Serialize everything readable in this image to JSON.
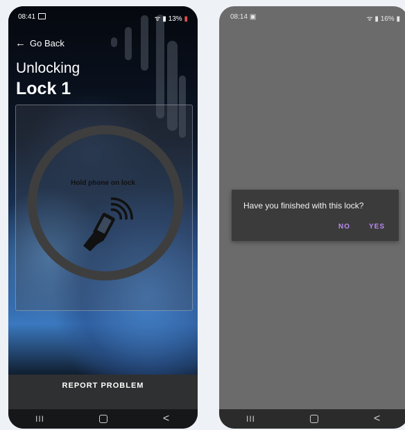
{
  "left_phone": {
    "status_bar": {
      "time": "08:41",
      "battery": "13%"
    },
    "header": {
      "back_label": "Go Back",
      "subtitle": "Unlocking",
      "title": "Lock 1"
    },
    "nfc_panel": {
      "instruction": "Hold phone on lock"
    },
    "report_button": {
      "label": "REPORT PROBLEM"
    },
    "nav": {
      "recents": "III",
      "back": "<"
    }
  },
  "right_phone": {
    "status_bar": {
      "time": "08:14",
      "battery": "16%"
    },
    "dialog": {
      "message": "Have you finished with this lock?",
      "no_label": "NO",
      "yes_label": "YES"
    },
    "nav": {
      "recents": "III",
      "back": "<"
    }
  },
  "colors": {
    "accent": "#b98af0",
    "dialog_bg": "#3b3b3b",
    "report_bg": "#2f3031"
  }
}
